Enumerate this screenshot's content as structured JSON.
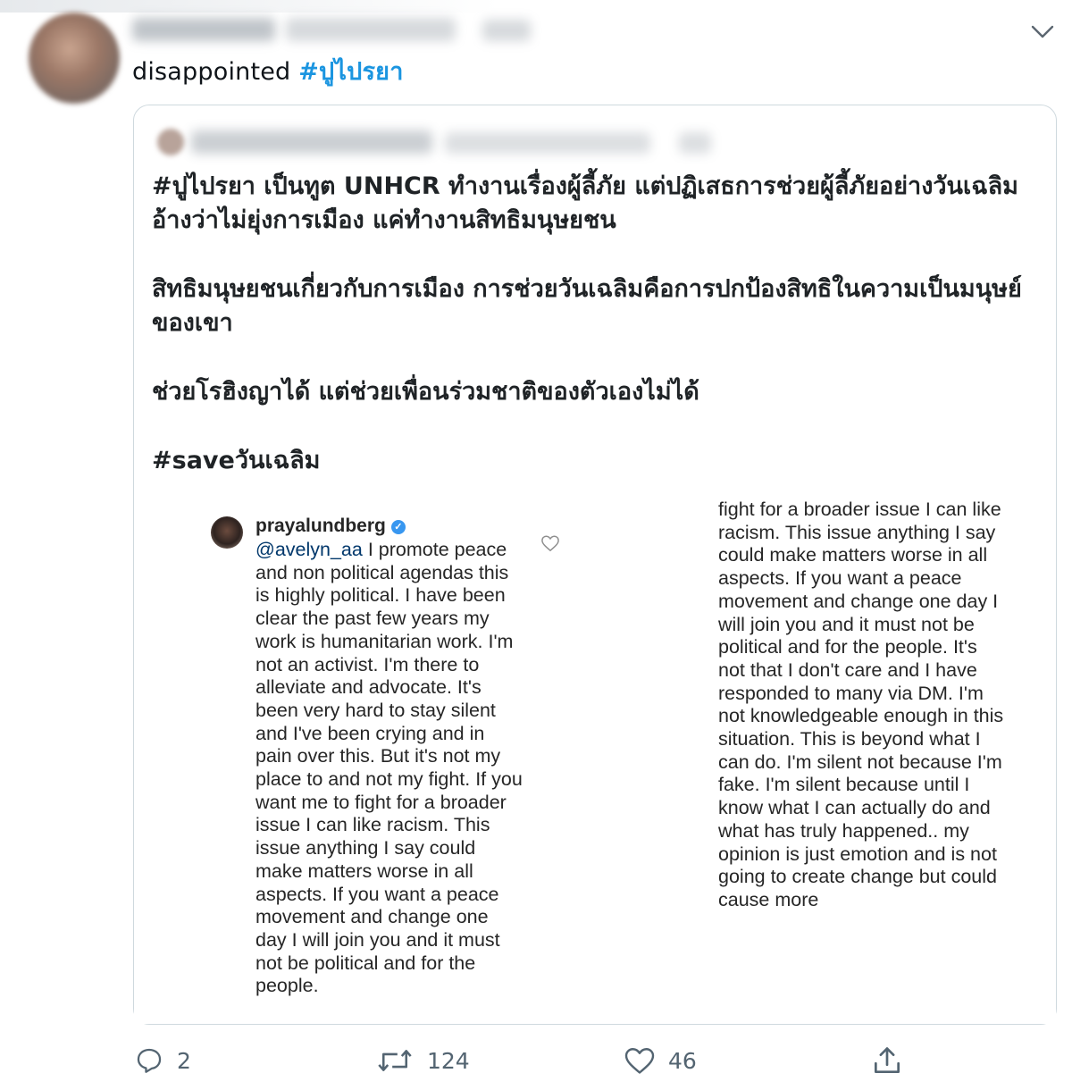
{
  "tweet": {
    "text": "disappointed",
    "hashtag": "#ปูไปรยา"
  },
  "quoted_tweet": {
    "paragraphs": [
      "#ปูไปรยา เป็นทูต UNHCR ทำงานเรื่องผู้ลี้ภัย แต่ปฏิเสธการช่วยผู้ลี้ภัยอย่างวันเฉลิม อ้างว่าไม่ยุ่งการเมือง แค่ทำงานสิทธิมนุษยชน",
      "สิทธิมนุษยชนเกี่ยวกับการเมือง การช่วยวันเฉลิมคือการปกป้องสิทธิในความเป็นมนุษย์ของเขา",
      "ช่วยโรฮิงญาได้ แต่ช่วยเพื่อนร่วมชาติของตัวเองไม่ได้",
      "#saveวันเฉลิม"
    ],
    "instagram_screenshot": {
      "username": "prayalundberg",
      "mention": "@avelyn_aa",
      "comment_left": " I promote peace and non political agendas this is highly political. I have been clear the past few years my work is humanitarian work. I'm not an activist. I'm there to alleviate and advocate. It's been very hard to stay silent and I've been crying and in pain over this. But it's not my place to and not my fight. If you want me to fight for a broader issue I can like racism. This issue anything I say could make matters worse in all aspects. If you want a peace movement and change one day I will join you and it must not be political and for the people.",
      "comment_right": "fight for a broader issue I can like racism. This issue anything I say could make matters worse in all aspects. If you want a peace movement and change one day I will join you and it must not be political and for the people. It's not that I don't care and I have responded to many via DM. I'm not knowledgeable enough in this situation. This is beyond what I can do. I'm silent not because I'm fake. I'm silent because until I know what I can actually do and what has truly happened.. my opinion is just emotion and is not going to create change but could cause more"
    }
  },
  "actions": {
    "reply_count": "2",
    "retweet_count": "124",
    "like_count": "46"
  },
  "colors": {
    "hashtag": "#1b95e0",
    "icon_gray": "#536471",
    "card_border": "#cfd9de"
  },
  "icons": [
    "chevron-down-icon",
    "reply-icon",
    "retweet-icon",
    "like-icon",
    "share-icon",
    "heart-icon",
    "verified-icon"
  ]
}
